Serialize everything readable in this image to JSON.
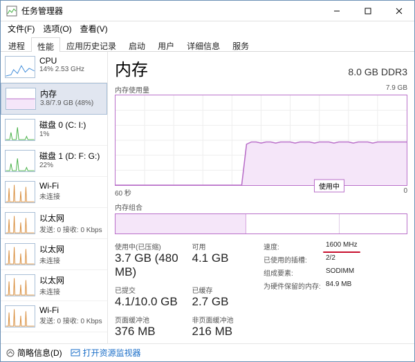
{
  "window": {
    "title": "任务管理器"
  },
  "menu": {
    "file": "文件(F)",
    "options": "选项(O)",
    "view": "查看(V)"
  },
  "tabs": [
    "进程",
    "性能",
    "应用历史记录",
    "启动",
    "用户",
    "详细信息",
    "服务"
  ],
  "active_tab": 1,
  "sidebar": {
    "items": [
      {
        "name": "CPU",
        "sub": "14% 2.53 GHz",
        "selected": false,
        "color": "#3b8ad9",
        "type": "cpu"
      },
      {
        "name": "内存",
        "sub": "3.8/7.9 GB (48%)",
        "selected": true,
        "color": "#b96fc9",
        "type": "mem"
      },
      {
        "name": "磁盘 0 (C: I:)",
        "sub": "1%",
        "selected": false,
        "color": "#3fae3f",
        "type": "disk"
      },
      {
        "name": "磁盘 1 (D: F: G:)",
        "sub": "22%",
        "selected": false,
        "color": "#3fae3f",
        "type": "disk"
      },
      {
        "name": "Wi-Fi",
        "sub": "未连接",
        "selected": false,
        "color": "#d88c3a",
        "type": "net"
      },
      {
        "name": "以太网",
        "sub": "发送: 0 接收: 0 Kbps",
        "selected": false,
        "color": "#d88c3a",
        "type": "net"
      },
      {
        "name": "以太网",
        "sub": "未连接",
        "selected": false,
        "color": "#d88c3a",
        "type": "net"
      },
      {
        "name": "以太网",
        "sub": "未连接",
        "selected": false,
        "color": "#d88c3a",
        "type": "net"
      },
      {
        "name": "Wi-Fi",
        "sub": "发送: 0 接收: 0 Kbps",
        "selected": false,
        "color": "#d88c3a",
        "type": "net"
      }
    ]
  },
  "main": {
    "title": "内存",
    "spec": "8.0 GB DDR3",
    "chart_label": "内存使用量",
    "chart_max": "7.9 GB",
    "xaxis_left": "60 秒",
    "xaxis_right": "0",
    "in_use_label": "使用中",
    "combo_label": "内存组合"
  },
  "stats": {
    "l": [
      {
        "lbl": "使用中(已压缩)",
        "val": "3.7 GB (480 MB)"
      },
      {
        "lbl": "可用",
        "val": "4.1 GB"
      },
      {
        "lbl": "已提交",
        "val": "4.1/10.0 GB"
      },
      {
        "lbl": "已缓存",
        "val": "2.7 GB"
      },
      {
        "lbl": "页面缓冲池",
        "val": "376 MB"
      },
      {
        "lbl": "非页面缓冲池",
        "val": "216 MB"
      }
    ],
    "r": [
      {
        "k": "速度:",
        "v": "1600 MHz",
        "hl": true
      },
      {
        "k": "已使用的插槽:",
        "v": "2/2"
      },
      {
        "k": "组成要素:",
        "v": "SODIMM"
      },
      {
        "k": "为硬件保留的内存:",
        "v": "84.9 MB"
      }
    ]
  },
  "footer": {
    "less": "简略信息(D)",
    "link": "打开资源监视器"
  },
  "chart_data": {
    "type": "area",
    "title": "内存使用量",
    "ylabel": "GB",
    "ylim": [
      0,
      7.9
    ],
    "xlim_seconds": [
      60,
      0
    ],
    "series": [
      {
        "name": "使用中",
        "unit": "GB",
        "values": [
          0,
          0,
          0,
          0,
          0,
          0,
          0,
          0,
          0,
          0,
          0,
          0,
          0,
          0,
          0,
          0,
          0,
          0,
          0,
          0,
          0,
          0,
          0,
          0,
          0,
          0,
          0,
          3.6,
          3.8,
          3.8,
          3.7,
          3.8,
          3.8,
          3.7,
          3.8,
          3.8,
          3.8,
          3.7,
          3.8,
          3.8,
          3.8,
          3.7,
          3.8,
          3.8,
          3.8,
          3.7,
          3.8,
          3.8,
          3.8,
          3.7,
          3.8,
          3.8,
          3.8,
          3.7,
          3.8,
          3.8,
          3.8,
          3.8,
          3.8,
          3.8,
          3.8
        ]
      }
    ]
  },
  "combo_data": {
    "segments": [
      0.45,
      0.32,
      0.23
    ]
  }
}
